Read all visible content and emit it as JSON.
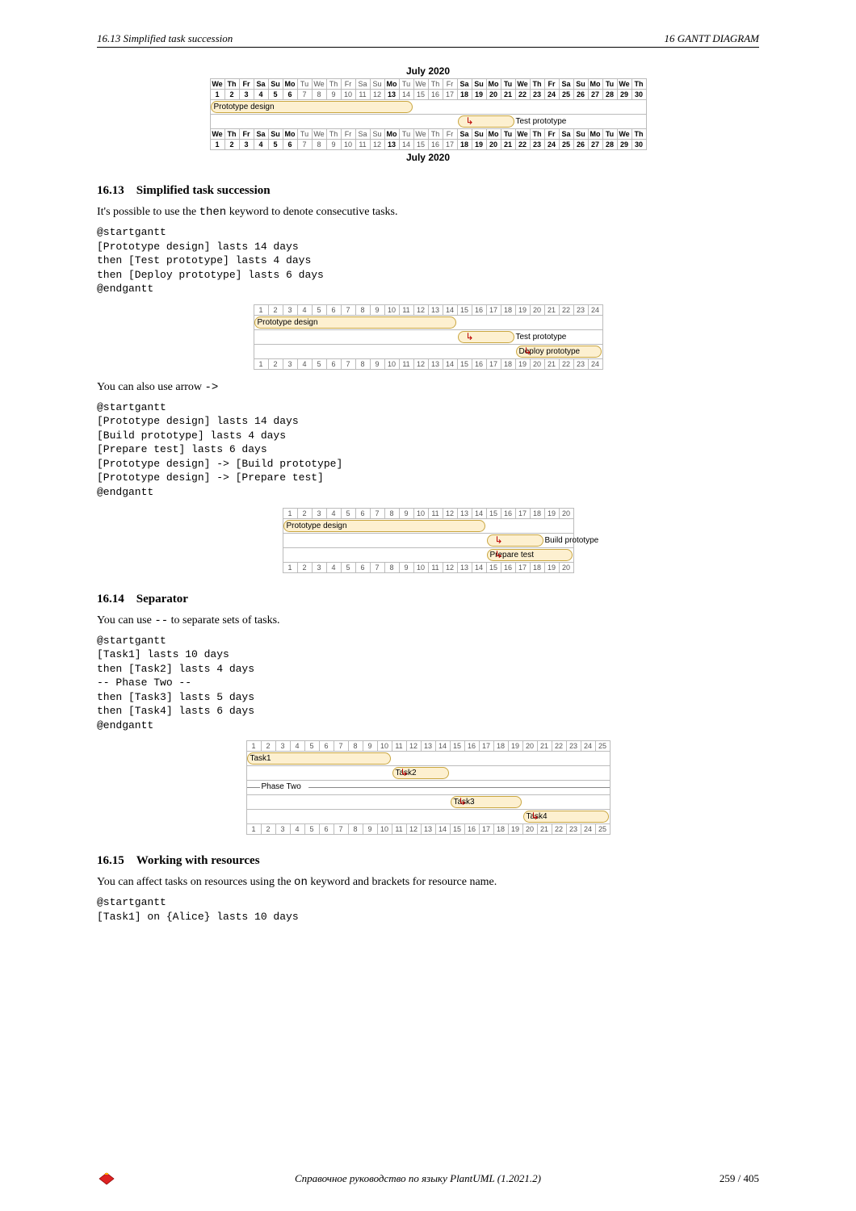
{
  "header": {
    "left": "16.13   Simplified task succession",
    "right": "16   GANTT DIAGRAM"
  },
  "gantt1": {
    "month_title": "July 2020",
    "day_names": [
      "We",
      "Th",
      "Fr",
      "Sa",
      "Su",
      "Mo",
      "Tu",
      "We",
      "Th",
      "Fr",
      "Sa",
      "Su",
      "Mo",
      "Tu",
      "We",
      "Th",
      "Fr",
      "Sa",
      "Su",
      "Mo",
      "Tu",
      "We",
      "Th",
      "Fr",
      "Sa",
      "Su",
      "Mo",
      "Tu",
      "We",
      "Th"
    ],
    "day_numbers": [
      1,
      2,
      3,
      4,
      5,
      6,
      7,
      8,
      9,
      10,
      11,
      12,
      13,
      14,
      15,
      16,
      17,
      18,
      19,
      20,
      21,
      22,
      23,
      24,
      25,
      26,
      27,
      28,
      29,
      30
    ],
    "bold_days": [
      1,
      2,
      3,
      4,
      5,
      6,
      13,
      18,
      19,
      20,
      21,
      22,
      23,
      24,
      25,
      26,
      27,
      28,
      29,
      30
    ],
    "tasks": [
      {
        "label": "Prototype design",
        "start": 1,
        "len": 14
      },
      {
        "label": "Test prototype",
        "start": 18,
        "len": 4
      }
    ]
  },
  "section1613": {
    "heading_num": "16.13",
    "heading_title": "Simplified task succession",
    "p1_a": "It's possible to use the ",
    "p1_code": "then",
    "p1_b": " keyword to denote consecutive tasks.",
    "code1": "@startgantt\n[Prototype design] lasts 14 days\nthen [Test prototype] lasts 4 days\nthen [Deploy prototype] lasts 6 days\n@endgantt",
    "p2_a": "You can also use arrow ",
    "p2_code": "->",
    "code2": "@startgantt\n[Prototype design] lasts 14 days\n[Build prototype] lasts 4 days\n[Prepare test] lasts 6 days\n[Prototype design] -> [Build prototype]\n[Prototype design] -> [Prepare test]\n@endgantt"
  },
  "gantt2": {
    "day_numbers": [
      1,
      2,
      3,
      4,
      5,
      6,
      7,
      8,
      9,
      10,
      11,
      12,
      13,
      14,
      15,
      16,
      17,
      18,
      19,
      20,
      21,
      22,
      23,
      24
    ],
    "tasks": [
      {
        "label": "Prototype design",
        "start": 1,
        "len": 14
      },
      {
        "label": "Test prototype",
        "start": 15,
        "len": 4,
        "label_out": true
      },
      {
        "label": "Deploy prototype",
        "start": 19,
        "len": 6
      }
    ]
  },
  "gantt3": {
    "day_numbers": [
      1,
      2,
      3,
      4,
      5,
      6,
      7,
      8,
      9,
      10,
      11,
      12,
      13,
      14,
      15,
      16,
      17,
      18,
      19,
      20
    ],
    "tasks": [
      {
        "label": "Prototype design",
        "start": 1,
        "len": 14
      },
      {
        "label": "Build prototype",
        "start": 15,
        "len": 4,
        "label_out": true
      },
      {
        "label": "Prepare test",
        "start": 15,
        "len": 6
      }
    ]
  },
  "section1614": {
    "heading_num": "16.14",
    "heading_title": "Separator",
    "p1_a": "You can use ",
    "p1_code": "--",
    "p1_b": " to separate sets of tasks.",
    "code1": "@startgantt\n[Task1] lasts 10 days\nthen [Task2] lasts 4 days\n-- Phase Two --\nthen [Task3] lasts 5 days\nthen [Task4] lasts 6 days\n@endgantt"
  },
  "gantt4": {
    "day_numbers": [
      1,
      2,
      3,
      4,
      5,
      6,
      7,
      8,
      9,
      10,
      11,
      12,
      13,
      14,
      15,
      16,
      17,
      18,
      19,
      20,
      21,
      22,
      23,
      24,
      25
    ],
    "task1": {
      "label": "Task1",
      "start": 1,
      "len": 10
    },
    "task2": {
      "label": "Task2",
      "start": 11,
      "len": 4
    },
    "separator": "Phase Two",
    "task3": {
      "label": "Task3",
      "start": 15,
      "len": 5
    },
    "task4": {
      "label": "Task4",
      "start": 20,
      "len": 6
    }
  },
  "section1615": {
    "heading_num": "16.15",
    "heading_title": "Working with resources",
    "p1_a": "You can affect tasks on resources using the ",
    "p1_code": "on",
    "p1_b": " keyword and brackets for resource name.",
    "code1": "@startgantt\n[Task1] on {Alice} lasts 10 days"
  },
  "footer": {
    "center": "Справочное руководство по языку PlantUML (1.2021.2)",
    "page": "259 / 405"
  },
  "chart_data": [
    {
      "type": "gantt",
      "title": "July 2020",
      "x": "date",
      "tasks": [
        {
          "name": "Prototype design",
          "start": 1,
          "end": 14
        },
        {
          "name": "Test prototype",
          "start": 18,
          "end": 21
        }
      ]
    },
    {
      "type": "gantt",
      "x": "day-index",
      "x_range": [
        1,
        24
      ],
      "tasks": [
        {
          "name": "Prototype design",
          "start": 1,
          "end": 14
        },
        {
          "name": "Test prototype",
          "start": 15,
          "end": 18
        },
        {
          "name": "Deploy prototype",
          "start": 19,
          "end": 24
        }
      ]
    },
    {
      "type": "gantt",
      "x": "day-index",
      "x_range": [
        1,
        20
      ],
      "tasks": [
        {
          "name": "Prototype design",
          "start": 1,
          "end": 14
        },
        {
          "name": "Build prototype",
          "start": 15,
          "end": 18
        },
        {
          "name": "Prepare test",
          "start": 15,
          "end": 20
        }
      ]
    },
    {
      "type": "gantt",
      "x": "day-index",
      "x_range": [
        1,
        25
      ],
      "separator": "Phase Two",
      "tasks": [
        {
          "name": "Task1",
          "start": 1,
          "end": 10
        },
        {
          "name": "Task2",
          "start": 11,
          "end": 14
        },
        {
          "name": "Task3",
          "start": 15,
          "end": 19
        },
        {
          "name": "Task4",
          "start": 20,
          "end": 25
        }
      ]
    }
  ]
}
